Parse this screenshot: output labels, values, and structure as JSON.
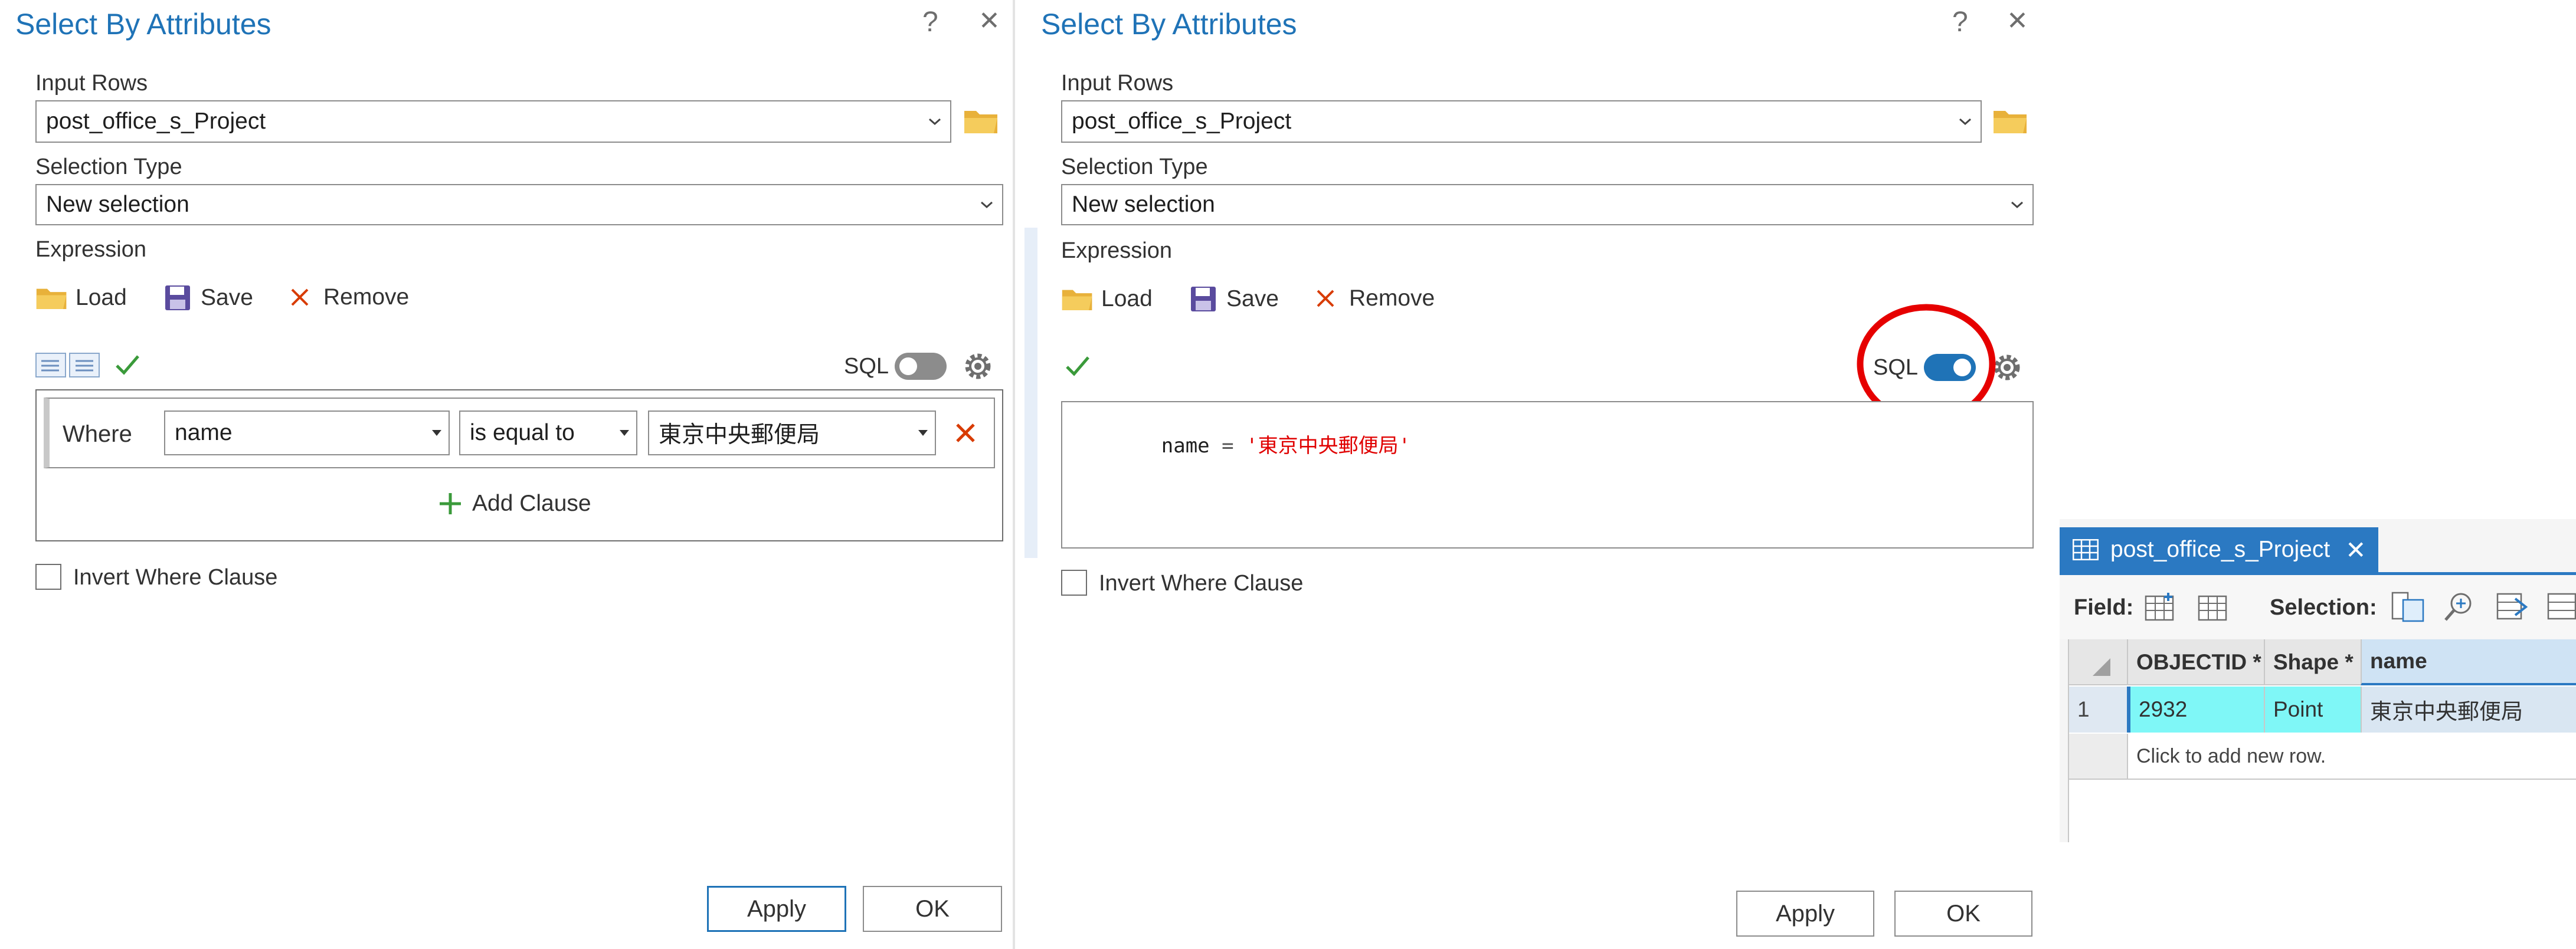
{
  "dialog_left": {
    "title": "Select By Attributes",
    "help_label": "?",
    "close_label": "✕",
    "input_rows_label": "Input Rows",
    "input_rows_value": "post_office_s_Project",
    "selection_type_label": "Selection Type",
    "selection_type_value": "New selection",
    "expression_label": "Expression",
    "load_label": "Load",
    "save_label": "Save",
    "remove_label": "Remove",
    "sql_label": "SQL",
    "sql_enabled": false,
    "where_label": "Where",
    "field_value": "name",
    "operator_value": "is equal to",
    "value_value": "東京中央郵便局",
    "add_clause_label": "Add Clause",
    "invert_label": "Invert Where Clause",
    "apply_label": "Apply",
    "ok_label": "OK"
  },
  "dialog_right": {
    "title": "Select By Attributes",
    "help_label": "?",
    "close_label": "✕",
    "input_rows_label": "Input Rows",
    "input_rows_value": "post_office_s_Project",
    "selection_type_label": "Selection Type",
    "selection_type_value": "New selection",
    "expression_label": "Expression",
    "load_label": "Load",
    "save_label": "Save",
    "remove_label": "Remove",
    "sql_label": "SQL",
    "sql_enabled": true,
    "sql_field": "name",
    "sql_operator": "=",
    "sql_value": "'東京中央郵便局'",
    "invert_label": "Invert Where Clause",
    "apply_label": "Apply",
    "ok_label": "OK"
  },
  "table_view": {
    "tab_title": "post_office_s_Project",
    "close_label": "✕",
    "field_label": "Field:",
    "selection_label": "Selection:",
    "columns": [
      "OBJECTID *",
      "Shape *",
      "name"
    ],
    "rows": [
      {
        "index": "1",
        "cells": [
          "2932",
          "Point",
          "東京中央郵便局"
        ]
      }
    ],
    "add_row_label": "Click to add new row."
  },
  "colors": {
    "accent": "#1f73b7",
    "title_blue": "#1f73b7",
    "toggle_on": "#1f73b7",
    "toggle_off": "#8c8c8c",
    "remove_red": "#d83b01",
    "check_green": "#3a9a3a",
    "folder_yellow": "#e8b13a",
    "sql_string_red": "#e00000",
    "annotation_red": "#e60000",
    "selected_row_cyan": "#7ff7f7",
    "table_header_bg": "#e6e6e6",
    "name_header_bg": "#cfe3f4",
    "tab_bg": "#2b79c2"
  },
  "icons": {
    "folder": "folder-icon",
    "save": "floppy-disk-icon",
    "remove": "x-icon",
    "check": "checkmark-icon",
    "gear": "gear-icon",
    "table": "table-icon"
  }
}
